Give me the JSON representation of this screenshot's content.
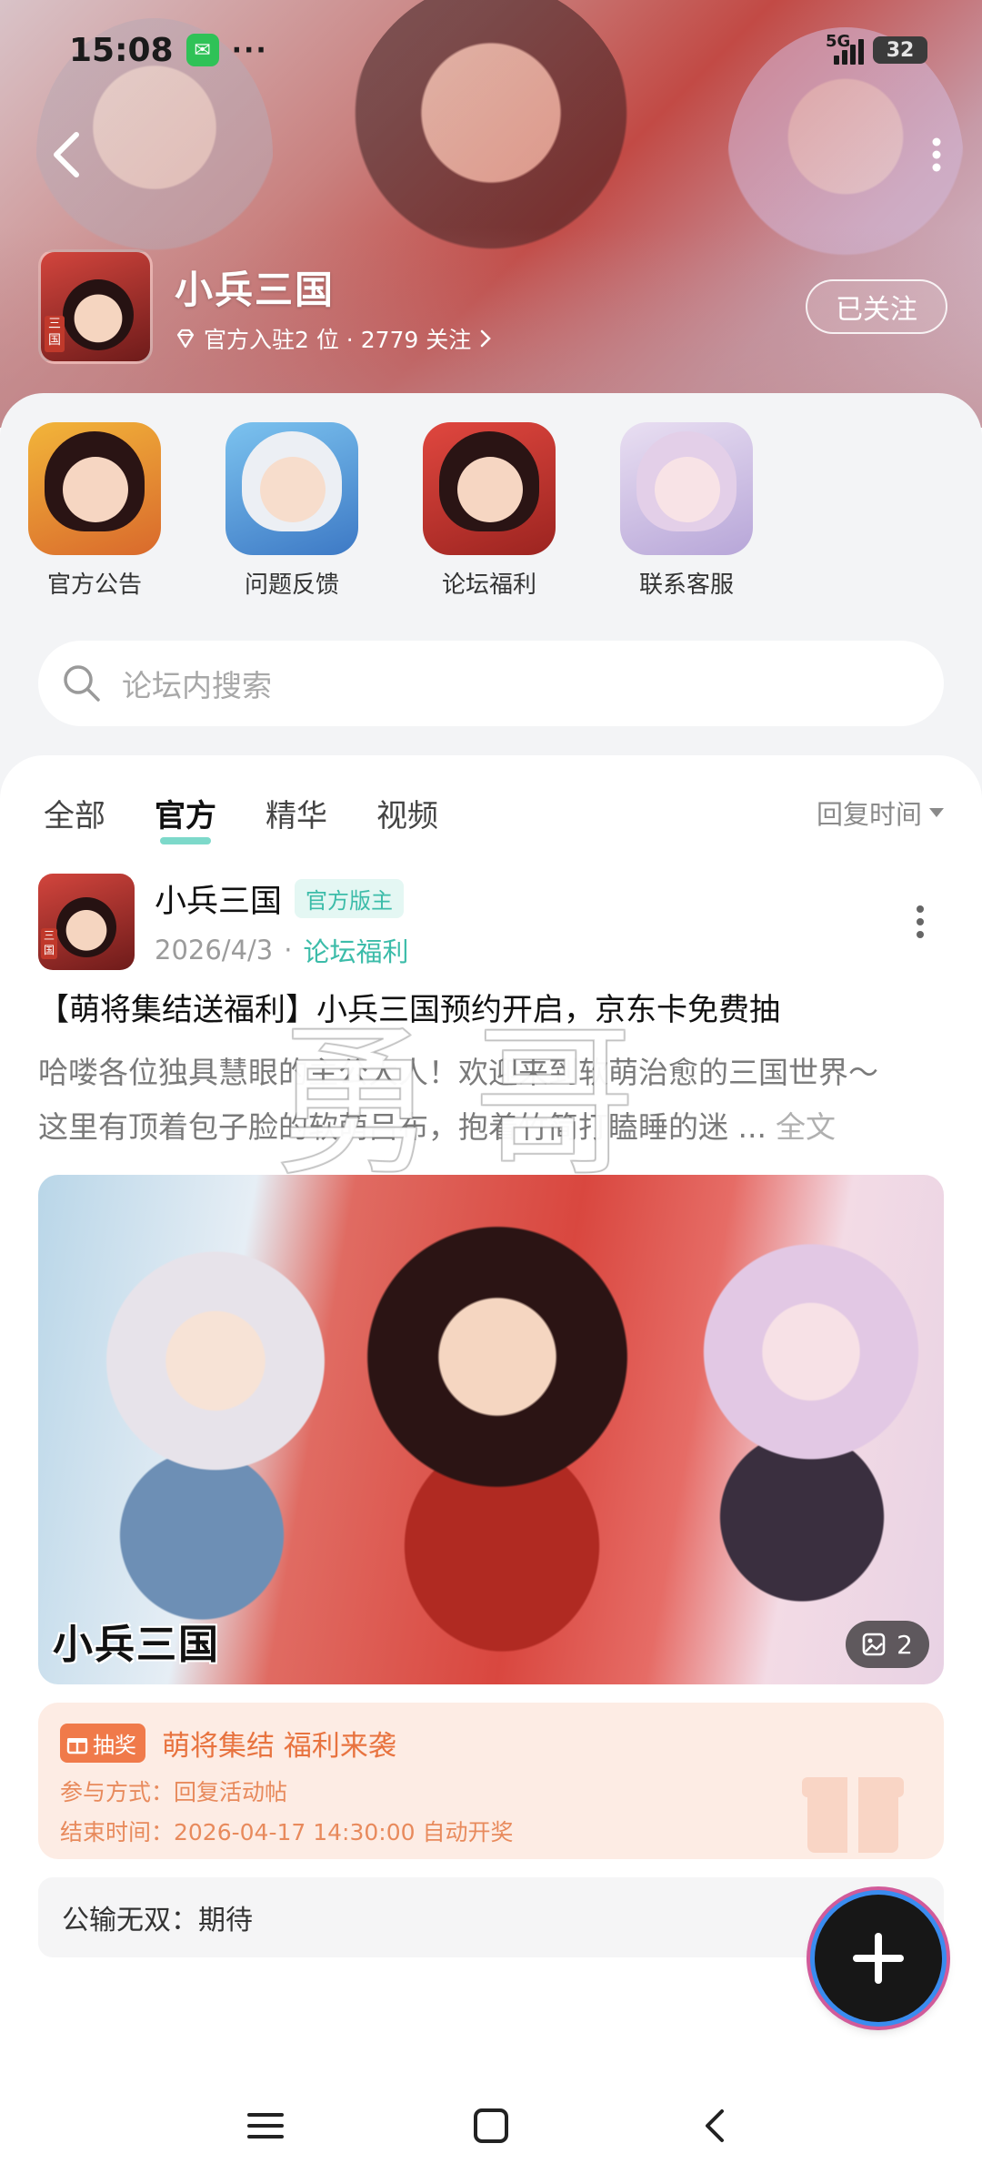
{
  "status_bar": {
    "time": "15:08",
    "dots": "···",
    "network": "5G",
    "battery": "32"
  },
  "forum": {
    "name": "小兵三国",
    "subtitle": "官方入驻2 位 · 2779 关注",
    "follow_label": "已关注",
    "logo_tag": "三国"
  },
  "quick_links": [
    {
      "label": "官方公告"
    },
    {
      "label": "问题反馈"
    },
    {
      "label": "论坛福利"
    },
    {
      "label": "联系客服"
    }
  ],
  "search": {
    "placeholder": "论坛内搜索"
  },
  "tabs": [
    {
      "label": "全部"
    },
    {
      "label": "官方"
    },
    {
      "label": "精华"
    },
    {
      "label": "视频"
    }
  ],
  "active_tab": "官方",
  "sort": {
    "label": "回复时间"
  },
  "post": {
    "author": "小兵三国",
    "badge": "官方版主",
    "date": "2026/4/3",
    "forum_name": "论坛福利",
    "title": "【萌将集结送福利】小兵三国预约开启，京东卡免费抽",
    "body_line1": "哈喽各位独具慧眼的主公大人！欢迎来到软萌治愈的三国世界～",
    "body_line2": "这里有顶着包子脸的软萌吕布，抱着竹简打瞌睡的迷 ...",
    "full_text": "全文",
    "image_logo": "小兵三国",
    "image_count": "2"
  },
  "lottery": {
    "tag": "抽奖",
    "title": "萌将集结 福利来袭",
    "method": "参与方式：回复活动帖",
    "end_time": "结束时间：2026-04-17 14:30:00 自动开奖"
  },
  "comment": {
    "text": "公输无双：期待"
  },
  "watermark": "勇哥",
  "colors": {
    "accent": "#3cbca9",
    "lottery": "#e8733f",
    "page_bg": "#f3f4f6"
  }
}
